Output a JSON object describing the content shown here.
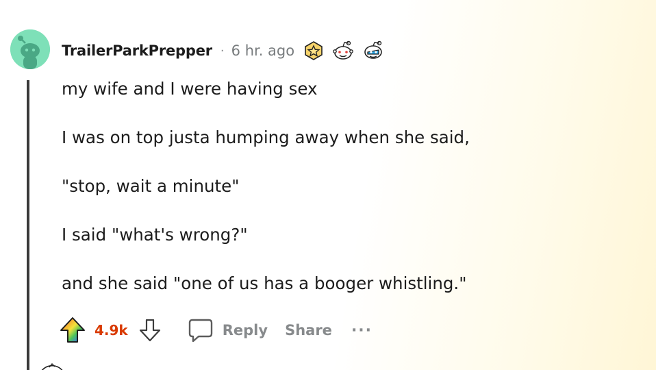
{
  "comment": {
    "username": "TrailerParkPrepper",
    "separator": "·",
    "timestamp": "6 hr. ago",
    "awards": [
      "star-award-icon",
      "wholesome-award-icon",
      "helpful-award-icon"
    ],
    "body": [
      "my wife and I were having sex",
      "I was on top justa humping away when she said,",
      "\"stop, wait a minute\"",
      "I said \"what's wrong?\"",
      "and she said \"one of us has a booger whistling.\""
    ],
    "actions": {
      "vote_count": "4.9k",
      "reply_label": "Reply",
      "share_label": "Share",
      "more_label": "···"
    }
  },
  "colors": {
    "username": "#1c1c1c",
    "meta": "#787c7e",
    "vote_count": "#d93a00",
    "action": "#878a8c",
    "avatar_bg": "#7ee0b8",
    "thread_line": "#3a3a3a"
  }
}
